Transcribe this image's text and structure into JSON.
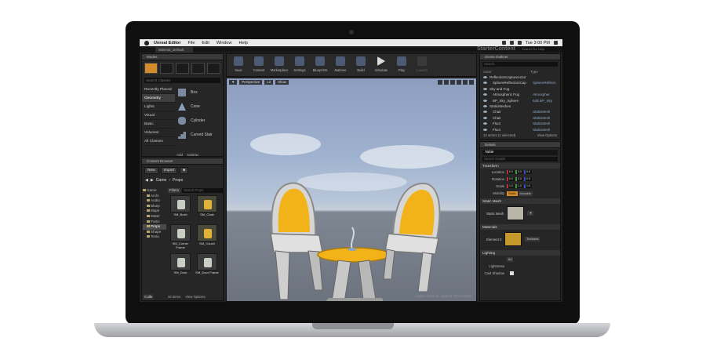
{
  "menubar": {
    "app": "Unreal Editor",
    "items": [
      "File",
      "Edit",
      "Window",
      "Help"
    ],
    "clock": "Tue 3:00 PM"
  },
  "tabbar": {
    "tab": "Minimal_Default",
    "project": "StarterContent",
    "search_placeholder": "Search For Help"
  },
  "modes": {
    "title": "Modes",
    "search_placeholder": "Search Classes",
    "categories": [
      "Recently Placed",
      "Geometry",
      "Lights",
      "Visual",
      "Basic",
      "Volumes",
      "All Classes"
    ],
    "selected_category": "Geometry",
    "shapes": [
      "Box",
      "Cone",
      "Cylinder",
      "Curved Stair"
    ],
    "add_label": "Add",
    "subtract_label": "Subtrac"
  },
  "content_browser": {
    "title": "Content Browser",
    "new_label": "New",
    "import_label": "Import",
    "path": [
      "Game",
      "Props"
    ],
    "filters_label": "Filters",
    "search_placeholder": "Search Props",
    "tree": [
      "Game",
      "Archi",
      "Audio",
      "Bluep",
      "Maps",
      "Mater",
      "Partic",
      "Props",
      "Shape",
      "Textu"
    ],
    "selected_folder": "Props",
    "assets": [
      "SM_Bush",
      "SM_Chair",
      "SM_Corner Frame",
      "SM_Couch",
      "SM_Door",
      "SM_Door Frame"
    ],
    "items_count": "20 items",
    "view_options": "View Options",
    "collections": "Colle"
  },
  "toolbar": {
    "tools": [
      "Save",
      "Content",
      "Marketplace",
      "Settings",
      "Blueprints",
      "Matinee",
      "Build",
      "Simulate",
      "Play",
      "Launch"
    ]
  },
  "viewport": {
    "perspective": "Perspective",
    "lit": "Lit",
    "show": "Show",
    "level_label": "Level:",
    "level_name": "Minimal_Default (Persistent)"
  },
  "outliner": {
    "title": "Scene Outliner",
    "search_placeholder": "Search...",
    "col_actor": "Actor",
    "col_type": "Type",
    "rows": [
      {
        "name": "ReflectionCaptureActor",
        "type": ""
      },
      {
        "name": "SphereReflectionCap",
        "type": "SphereReflecti"
      },
      {
        "name": "Sky and Fog",
        "type": ""
      },
      {
        "name": "Atmospheric Fog",
        "type": "Atmospher"
      },
      {
        "name": "BP_Sky_Sphere",
        "type": "Edit BP_Sky"
      },
      {
        "name": "StaticMeshes",
        "type": ""
      },
      {
        "name": "Chair",
        "type": "StaticMesh"
      },
      {
        "name": "Chair",
        "type": "StaticMesh"
      },
      {
        "name": "Floor",
        "type": "StaticMesh"
      },
      {
        "name": "Floor",
        "type": "StaticMesh"
      }
    ],
    "summary": "13 actors (1 selected)",
    "view_options": "View Options"
  },
  "details": {
    "title": "Details",
    "object_name": "Table",
    "search_placeholder": "Search Details",
    "sections": {
      "transform": "Transform",
      "static_mesh": "Static Mesh",
      "materials": "Materials",
      "lighting": "Lighting"
    },
    "location_label": "Location",
    "rotation_label": "Rotation",
    "scale_label": "Scale",
    "mobility_label": "Mobility",
    "location": [
      "0.0",
      "0.0",
      "0.0"
    ],
    "rotation": [
      "0.0",
      "0.0",
      "0.0"
    ],
    "scale": [
      "1.0",
      "1.0",
      "1.0"
    ],
    "mobility": [
      "Static",
      "Movable"
    ],
    "static_mesh_label": "Static Mesh",
    "element_label": "Element 0",
    "textures_label": "Textures",
    "lightmass_label": "Lightmass",
    "cast_shadow_label": "Cast Shadow",
    "lightmap_value": "64"
  },
  "colors": {
    "accent": "#d48b2c",
    "chair_yellow": "#f2b31a",
    "panel_bg": "#262626"
  }
}
